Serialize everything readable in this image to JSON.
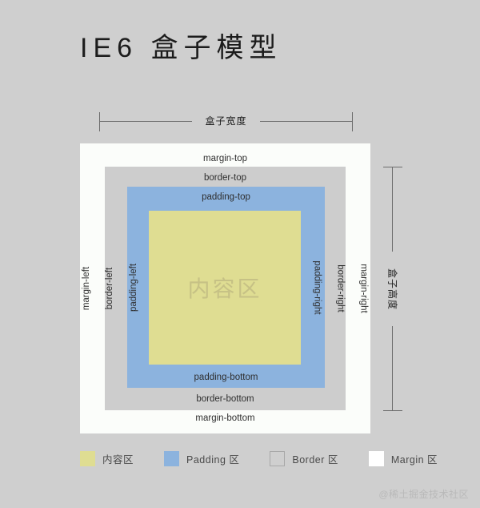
{
  "page": {
    "title": "IE6 盒子模型",
    "background_color": "#cfcfcf",
    "watermark": "@稀土掘金技术社区"
  },
  "dimensions": {
    "width_label": "盒子宽度",
    "height_label": "盒子高度",
    "line_color": "#6d6d6d"
  },
  "box_model": {
    "margin": {
      "name": "margin",
      "color": "#fbfdfa",
      "top_label": "margin-top",
      "bottom_label": "margin-bottom",
      "left_label": "margin-left",
      "right_label": "margin-right"
    },
    "border": {
      "name": "border",
      "color": "#cdcdcd",
      "top_label": "border-top",
      "bottom_label": "border-bottom",
      "left_label": "border-left",
      "right_label": "border-right"
    },
    "padding": {
      "name": "padding",
      "color": "#8cb3de",
      "top_label": "padding-top",
      "bottom_label": "padding-bottom",
      "left_label": "padding-left",
      "right_label": "padding-right"
    },
    "content": {
      "name": "content",
      "color": "#dfdd92",
      "label": "内容区",
      "label_color": "#c6c185"
    }
  },
  "legend": {
    "items": [
      {
        "label": "内容区",
        "color": "#dfdd92",
        "border": "#dfdd92",
        "icon": "color-swatch"
      },
      {
        "label": "Padding 区",
        "color": "#8cb3de",
        "border": "#8cb3de",
        "icon": "color-swatch"
      },
      {
        "label": "Border 区",
        "color": "transparent",
        "border": "#a8a8a8",
        "icon": "color-swatch"
      },
      {
        "label": "Margin 区",
        "color": "#ffffff",
        "border": "#ffffff",
        "icon": "color-swatch"
      }
    ]
  }
}
